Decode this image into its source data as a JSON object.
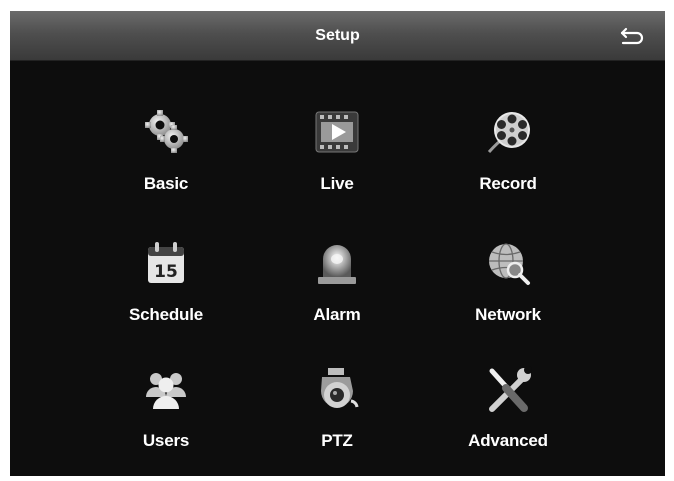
{
  "header": {
    "title": "Setup",
    "back_icon": "return-arrow-icon"
  },
  "menu": [
    {
      "label": "Basic",
      "icon": "gears-icon"
    },
    {
      "label": "Live",
      "icon": "video-play-icon"
    },
    {
      "label": "Record",
      "icon": "film-reel-icon"
    },
    {
      "label": "Schedule",
      "icon": "calendar-icon"
    },
    {
      "label": "Alarm",
      "icon": "alarm-siren-icon"
    },
    {
      "label": "Network",
      "icon": "globe-search-icon"
    },
    {
      "label": "Users",
      "icon": "users-icon"
    },
    {
      "label": "PTZ",
      "icon": "ptz-dome-camera-icon"
    },
    {
      "label": "Advanced",
      "icon": "wrench-screwdriver-icon"
    }
  ],
  "calendar_day": "15"
}
